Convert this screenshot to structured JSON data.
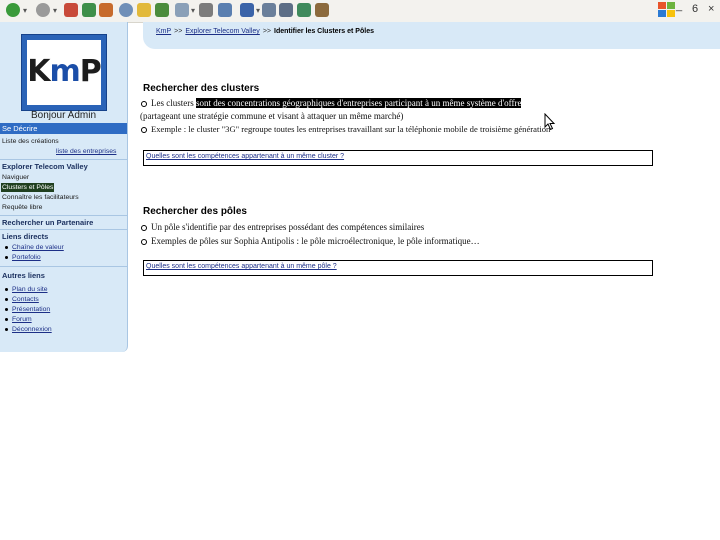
{
  "toolbar": {
    "icons": [
      "back-icon",
      "forward-icon",
      "stop-icon",
      "refresh-icon",
      "home-icon",
      "search-icon",
      "favorites-icon",
      "history-icon",
      "mail-icon",
      "print-icon",
      "edit-icon",
      "discuss-icon",
      "messenger-icon",
      "research-icon"
    ],
    "win_minimize": "_",
    "win_restore": "6",
    "win_close": "×"
  },
  "sidebar": {
    "logo": {
      "k": "K",
      "m": "m",
      "p": "P"
    },
    "greeting": "Bonjour Admin",
    "section_decrire": "Se Décrire",
    "decrire_links": [
      "Liste des créations",
      "liste des entreprises"
    ],
    "section_explorer": "Explorer Telecom Valley",
    "explorer_links": [
      "Naviguer",
      "Clusters et Pôles",
      "Connaître les facilitateurs",
      "Requête libre"
    ],
    "section_partenaire": "Rechercher un Partenaire",
    "section_liens": "Liens directs",
    "liens_links": [
      "Chaîne de valeur",
      "Portefolio"
    ],
    "section_autres": "Autres liens",
    "autres_links": [
      "Plan du site",
      "Contacts",
      "Présentation",
      "Forum",
      "Déconnexion"
    ]
  },
  "breadcrumb": {
    "home": "KmP",
    "sep": ">>",
    "explorer": "Explorer Telecom Valley",
    "current": "Identifier les Clusters et Pôles"
  },
  "clusters": {
    "title": "Rechercher des clusters",
    "line1_pre": "Les clusters ",
    "line1_hl": "sont des concentrations géographiques d'entreprises participant à un même système d'offre",
    "line2": "(partageant une stratégie commune et visant à attaquer un même marché)",
    "line3": "Exemple : le cluster \"3G\" regroupe toutes les entreprises travaillant sur la téléphonie mobile de troisième génération",
    "question": "Quelles sont les compétences appartenant à un même cluster ?"
  },
  "poles": {
    "title": "Rechercher des pôles",
    "line1": "Un pôle s'identifie par des entreprises possédant des compétences similaires",
    "line2": "Exemples de pôles sur Sophia Antipolis : le pôle microélectronique, le pôle informatique…",
    "question": "Quelles sont les compétences appartenant à un même pôle ?"
  },
  "colors": {
    "sidebar_bg": "#d8e9f7",
    "section_blue": "#2f6cc4",
    "logo_blue": "#2a63b7"
  }
}
